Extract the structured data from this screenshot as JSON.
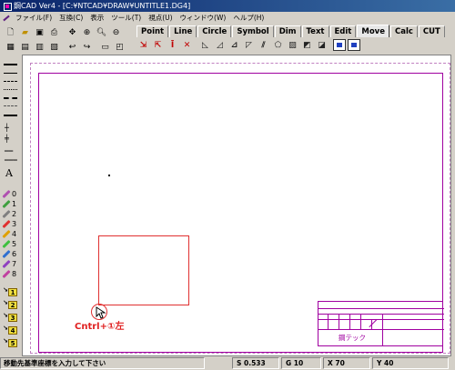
{
  "window": {
    "title": "鋼CAD Ver4 - [C:¥NTCAD¥DRAW¥UNTITLE1.DG4]"
  },
  "menu": [
    {
      "label": "ファイル(F)"
    },
    {
      "label": "互換(C)"
    },
    {
      "label": "表示"
    },
    {
      "label": "ツール(T)"
    },
    {
      "label": "視点(U)"
    },
    {
      "label": "ウィンドウ(W)"
    },
    {
      "label": "ヘルプ(H)"
    }
  ],
  "tabs": [
    {
      "label": "Point"
    },
    {
      "label": "Line"
    },
    {
      "label": "Circle"
    },
    {
      "label": "Symbol"
    },
    {
      "label": "Dim"
    },
    {
      "label": "Text"
    },
    {
      "label": "Edit"
    },
    {
      "label": "Move",
      "active": true
    },
    {
      "label": "Calc"
    },
    {
      "label": "CUT"
    }
  ],
  "left_tools": {
    "text_tool": "A",
    "pens": [
      {
        "label": "0",
        "color": "#b050b0"
      },
      {
        "label": "1",
        "color": "#40a040"
      },
      {
        "label": "2",
        "color": "#808080"
      },
      {
        "label": "3",
        "color": "#e03030"
      },
      {
        "label": "4",
        "color": "#e0a000"
      },
      {
        "label": "5",
        "color": "#40c040"
      },
      {
        "label": "6",
        "color": "#3070d0"
      },
      {
        "label": "7",
        "color": "#9040c0"
      },
      {
        "label": "8",
        "color": "#c040a0"
      }
    ],
    "layers": [
      {
        "label": "1"
      },
      {
        "label": "2"
      },
      {
        "label": "3"
      },
      {
        "label": "4"
      },
      {
        "label": "5"
      }
    ]
  },
  "canvas": {
    "annotation": "Cntrl+①左",
    "title_block_company": "鋼テック"
  },
  "status": {
    "message": "移動先基準座標を入力して下さい",
    "s": "S 0.533",
    "g": "G 10",
    "x": "X 70",
    "y": "Y 40"
  },
  "colors": {
    "sheet": "#a000a0",
    "accent_red": "#e03030"
  }
}
